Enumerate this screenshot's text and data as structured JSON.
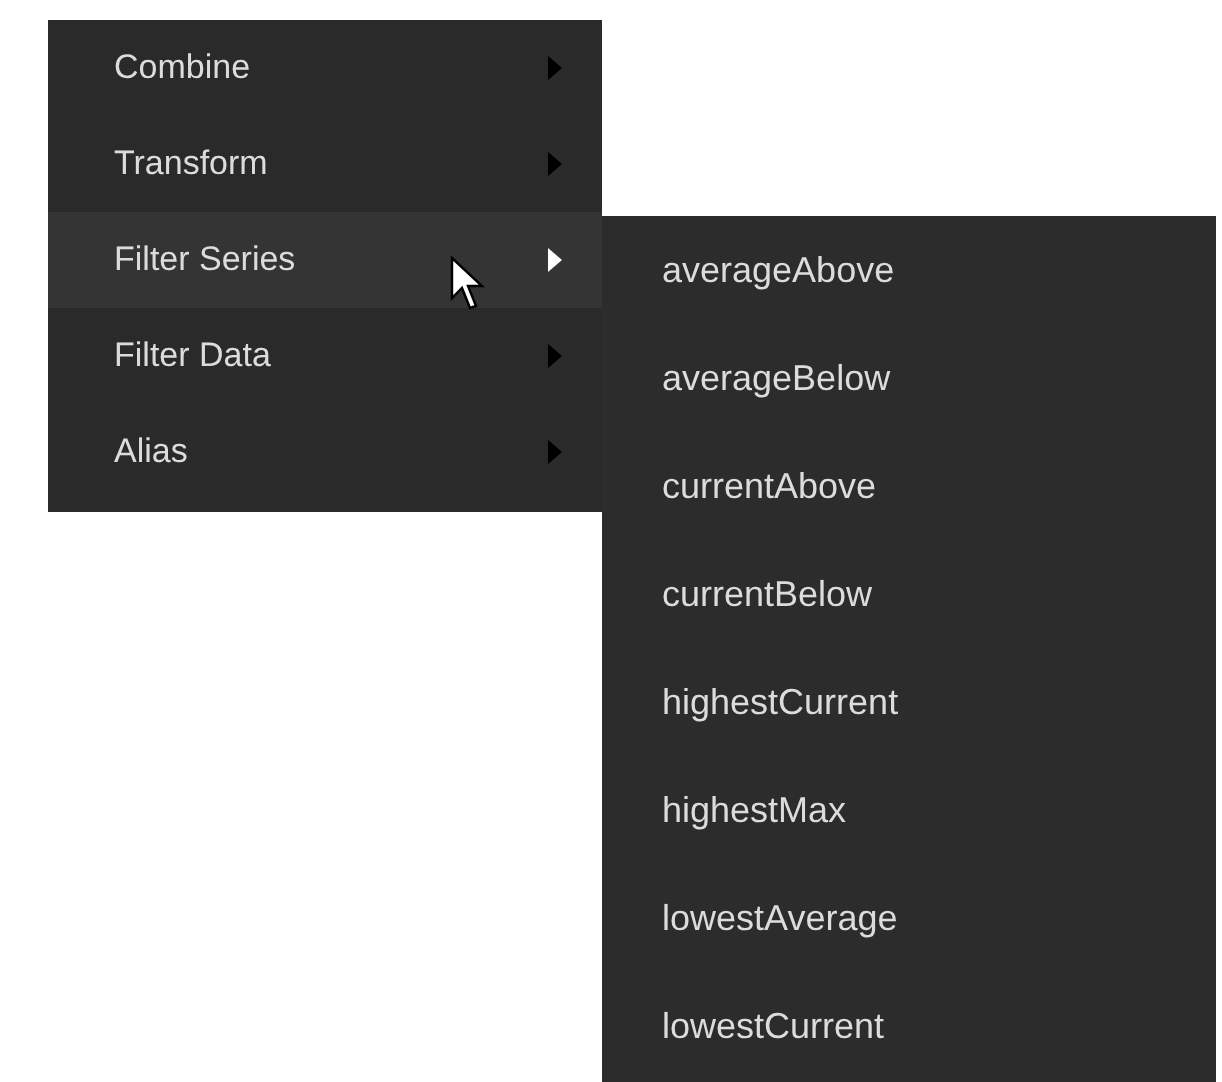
{
  "menu": {
    "items": [
      {
        "label": "Combine",
        "selected": false
      },
      {
        "label": "Transform",
        "selected": false
      },
      {
        "label": "Filter Series",
        "selected": true
      },
      {
        "label": "Filter Data",
        "selected": false
      },
      {
        "label": "Alias",
        "selected": false
      }
    ]
  },
  "submenu": {
    "items": [
      "averageAbove",
      "averageBelow",
      "currentAbove",
      "currentBelow",
      "highestCurrent",
      "highestMax",
      "lowestAverage",
      "lowestCurrent"
    ]
  }
}
